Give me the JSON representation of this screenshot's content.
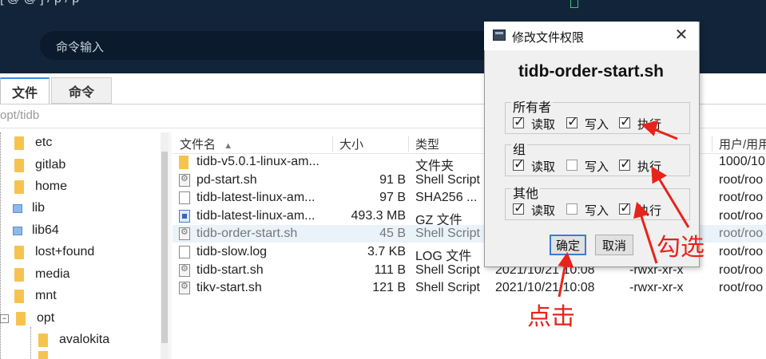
{
  "terminal": {
    "command_line": "[    @          @          ]                       /  p     /       p",
    "command_input_placeholder": "命令输入"
  },
  "tabs": [
    {
      "label": "文件",
      "active": true
    },
    {
      "label": "命令",
      "active": false
    }
  ],
  "path": "opt/tidb",
  "tree": [
    "etc",
    "gitlab",
    "home",
    "lib",
    "lib64",
    "lost+found",
    "media",
    "mnt",
    "opt",
    "avalokita"
  ],
  "file_list": {
    "headers": [
      "文件名",
      "大小",
      "类型",
      "用户/用用"
    ],
    "rows": [
      {
        "name": "tidb-v5.0.1-linux-am...",
        "size": "",
        "type": "文件夹",
        "date": "",
        "perm": "",
        "owner": "1000/10",
        "icon": "folder-icon"
      },
      {
        "name": "pd-start.sh",
        "size": "91 B",
        "type": "Shell Script",
        "date": "",
        "perm": "",
        "owner": "root/roo",
        "icon": "script-icon"
      },
      {
        "name": "tidb-latest-linux-am...",
        "size": "97 B",
        "type": "SHA256 ...",
        "date": "",
        "perm": "",
        "owner": "root/roo",
        "icon": "document-icon"
      },
      {
        "name": "tidb-latest-linux-am...",
        "size": "493.3 MB",
        "type": "GZ 文件",
        "date": "",
        "perm": "",
        "owner": "root/roo",
        "icon": "archive-icon"
      },
      {
        "name": "tidb-order-start.sh",
        "size": "45 B",
        "type": "Shell Script",
        "date": "",
        "perm": "",
        "owner": "root/roo",
        "icon": "script-icon",
        "selected": true
      },
      {
        "name": "tidb-slow.log",
        "size": "3.7 KB",
        "type": "LOG 文件",
        "date": "",
        "perm": "",
        "owner": "root/roo",
        "icon": "document-icon"
      },
      {
        "name": "tidb-start.sh",
        "size": "111 B",
        "type": "Shell Script",
        "date": "2021/10/21 10:08",
        "perm": "-rwxr-xr-x",
        "owner": "root/roo",
        "icon": "script-icon"
      },
      {
        "name": "tikv-start.sh",
        "size": "121 B",
        "type": "Shell Script",
        "date": "2021/10/21 10:08",
        "perm": "-rwxr-xr-x",
        "owner": "root/roo",
        "icon": "script-icon"
      }
    ]
  },
  "dialog": {
    "title": "修改文件权限",
    "close_glyph": "✕",
    "filename": "tidb-order-start.sh",
    "groups": [
      {
        "label": "所有者",
        "read": true,
        "write": true,
        "exec": true
      },
      {
        "label": "组",
        "read": true,
        "write": false,
        "exec": true
      },
      {
        "label": "其他",
        "read": true,
        "write": false,
        "exec": true
      }
    ],
    "read_label": "读取",
    "write_label": "写入",
    "exec_label": "执行",
    "ok_label": "确定",
    "cancel_label": "取消"
  },
  "annotations": {
    "check_note": "勾选",
    "click_note": "点击",
    "color": "#e8231a"
  }
}
